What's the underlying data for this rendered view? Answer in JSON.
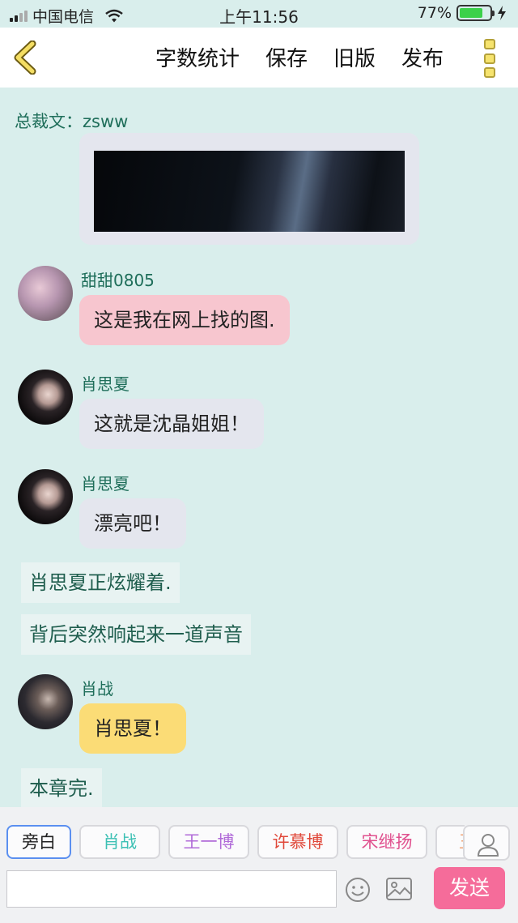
{
  "status_bar": {
    "carrier": "中国电信",
    "time": "上午11:56",
    "battery": "77%",
    "battery_level": 0.77
  },
  "toolbar": {
    "back_icon": "chevron-left-icon",
    "actions": [
      "字数统计",
      "保存",
      "旧版",
      "发布"
    ],
    "more_icon": "more-vertical-icon"
  },
  "content": {
    "author_line": "总裁文：zsww",
    "messages": [
      {
        "name": "甜甜0805",
        "text": "这是我在网上找的图."
      },
      {
        "name": "肖思夏",
        "text": "这就是沈晶姐姐！"
      },
      {
        "name": "肖思夏",
        "text": "漂亮吧！"
      },
      {
        "name": "肖战",
        "text": "肖思夏！"
      }
    ],
    "narrations": [
      "肖思夏正炫耀着.",
      "背后突然响起来一道声音",
      "本章完."
    ]
  },
  "composer": {
    "roles": [
      "旁白",
      "肖战",
      "王一博",
      "许慕博",
      "宋继扬",
      "王一"
    ],
    "role_colors": [
      "#222222",
      "#3cc0b4",
      "#b06ad8",
      "#e0483a",
      "#e0508e",
      "#f0a070"
    ],
    "input_value": "",
    "send_label": "发送",
    "accent": "#f56c9a"
  }
}
